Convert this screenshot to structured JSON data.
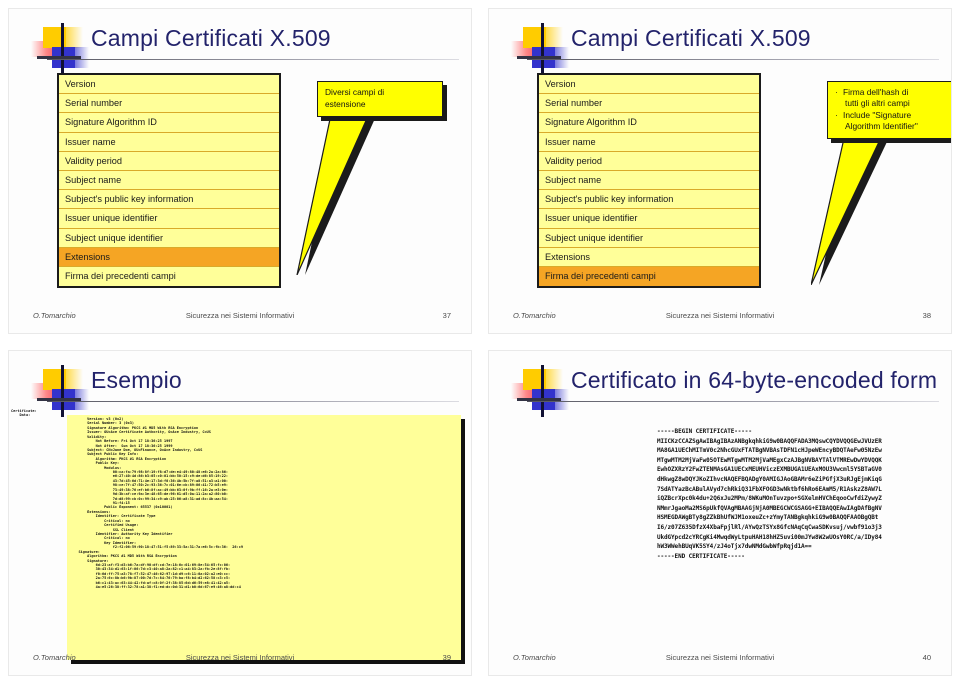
{
  "deck": {
    "footer_author": "O.Tomarchio",
    "footer_course": "Sicurezza nei Sistemi Informativi"
  },
  "colors": {
    "title_blue": "#23236b",
    "row_yellow": "#ffff99",
    "row_highlight_orange": "#f5a524",
    "callout_yellow": "#ffff00",
    "logo_yellow": "#ffcc00",
    "logo_blue": "#3333cc",
    "logo_red": "#e8384f",
    "code_background": "#ffff99"
  },
  "slide1": {
    "title": "Campi Certificati X.509",
    "page": "37",
    "fields": [
      "Version",
      "Serial number",
      "Signature Algorithm ID",
      "Issuer name",
      "Validity period",
      "Subject name",
      "Subject's public key information",
      "Issuer unique identifier",
      "Subject unique identifier",
      "Extensions",
      "Firma dei precedenti campi"
    ],
    "highlight_index": 9,
    "callout": {
      "line1": "Diversi campi di",
      "line2": "estensione"
    }
  },
  "slide2": {
    "title": "Campi Certificati X.509",
    "page": "38",
    "fields": [
      "Version",
      "Serial number",
      "Signature Algorithm ID",
      "Issuer name",
      "Validity period",
      "Subject name",
      "Subject's public key information",
      "Issuer unique identifier",
      "Subject unique identifier",
      "Extensions",
      "Firma dei precedenti campi"
    ],
    "highlight_index": 10,
    "callout": {
      "bullets": [
        {
          "line1": "Firma dell'hash di",
          "line2": "tutti gli altri campi"
        },
        {
          "line1": "Include \"Signature",
          "line2": "Algorithm Identifier\""
        }
      ]
    }
  },
  "slide3": {
    "title": "Esempio",
    "page": "39",
    "code_head": "Certificate:\n    Data:",
    "code": "        Version: v3 (0x2)\n        Serial Number: 3 (0x3)\n        Signature Algorithm: PKCS #1 MD5 With RSA Encryption\n        Issuer: OU=Ace Certificate Authority, O=Ace Industry, C=US\n        Validity:\n            Not Before: Fri Oct 17 18:36:25 1997\n            Not After:  Sun Oct 17 18:36:25 1999\n        Subject: CN=Jane Doe, OU=Finance, O=Ace Industry, C=US\n        Subject Public Key Info:\n            Algorithm: PKCS #1 RSA Encryption\n            Public Key:\n                Modulus:\n                    00:ca:fa:79:98:8f:19:f8:d7:de:e4:49:80:48:e6:2a:2a:86:\n                    e6:27:40:4d:86:b3:05:c0:01:bb:50:15:c9:de:d6:85:19:22:\n                    43:7d:45:6d:71:4e:17:3d:f0:36:4b:5b:7f:a8:51:a3:a1:00:\n                    98:ce:7f:47:50:2c:93:36:7c:01:6e:cb:89:06:41:72:b5:e9:\n                    73:49:38:76:ef:b6:8f:ac:49:bb:63:0f:9b:ff:16:2a:e3:0e:\n                    9d:3b:af:ce:9a:3e:48:65:de:96:61:d5:0a:11:2a:a2:80:b0:\n                    7d:d8:99:cb:0c:99:34:c9:ab:25:06:a8:31:ad:8c:4b:aa:54:\n                    91:f4:15\n                Public Exponent: 65537 (0x10001)\n        Extensions:\n            Identifier: Certificate Type\n                Critical: no\n                Certified Usage:\n                    SSL Client\n            Identifier: Authority Key Identifier\n                Critical: no\n                Key Identifier:\n                    f2:f2:06:59:90:18:47:51:f5:89:33:5a:31:7a:e6:5c:fb:36:  26:c9\n    Signature:\n        Algorithm: PKCS #1 MD5 With RSA Encryption\n        Signature:\n            6d:23:af:f3:d3:b6:7a:df:90:df:cd:7e:18:6c:01:69:8e:54:65:fc:06:\n            30:43:34:d1:63:1f:06:7d:c3:40:a8:2a:82:c1:a4:83:2a:fb:2e:8f:fb:\n            f0:6d:ff:75:a3:78:f7:52:47:46:62:97:1d:d9:c6:11:0a:02:a2:e0:cc:\n            2a:75:6c:8b:b6:9b:87:00:7d:7c:84:76:79:ba:f8:b4:d2:62:58:c3:c5:\n            b6:c1:43:ac:63:44:42:fd:af:c8:0f:2f:38:85:6d:d6:59:e8:41:42:a5:\n            4a:e5:26:38:ff:32:78:a1:38:f1:ed:dc:0d:31:d1:b0:6d:67:e9:46:a8:dd:c4"
  },
  "slide4": {
    "title": "Certificato in 64-byte-encoded form",
    "page": "40",
    "code": "-----BEGIN CERTIFICATE-----\nMIICKzCCAZSgAwIBAgIBAzANBgkqhkiG9w0BAQQFADA3MQswCQYDVQQGEwJVUzER\nMA8GA1UEChMITmV0c2NhcGUxFTATBgNVBAsTDFN1cHJpeWEncyBDQTAeFw05NzEw\nMTgwMTM2MjVaFw05OTEwMTgwMTM2MjVaMEgxCzAJBgNVBAYTAlVTMREwDwYDVQQK\nEwhOZXRzY2FwZTENMAsGA1UECxMEUHViczEXMBUGA1UEAxMOU3Vwcml5YSBTaGV0\ndHkwgZ8wDQYJKoZIhvcNAQEFBQADgY0AMIGJAoGBAMr6eZiPGfjX3uRJgEjmKiqG\n7SdATYazBcABulAVyd7chRkiQ31FbXFOGD3wNktbf6hRo6EAmM5/R1AskzZ8AW7L\niQZBcrXpc0k4du+2Q6xJu2MPm/8WKuMOnTuvzpo+SGXelmHVChEqooCwfdiZywyZ\nNMmrJgaoMa2MS6pUkfQVAgMBAAGjNjA0MBEGCWCGSAGG+EIBAQQEAwIAgDAfBgNV\nHSMEGDAWgBTy8gZZkBhUfWJM1oxeuZc+zYmyTANBgkqhkiG9w0BAQQFAAOBgQBt\nI6/z07Z635DfzX4XbaFpjlRl/AYwQzTSYx8GfcNAqCqCwaSDKvsuj/vwbf91o3j3\nUkdGYpcd2cYRCgKi4MwqdWyLtpuHAH18hHZ5uvi00mJYw8W2wUOsY0RC/a/IDy84\nhW3WWehBUqVK5SY4/zJ4oTjx7dwNMdGwbWfpRqjd1A==\n-----END CERTIFICATE-----"
  }
}
